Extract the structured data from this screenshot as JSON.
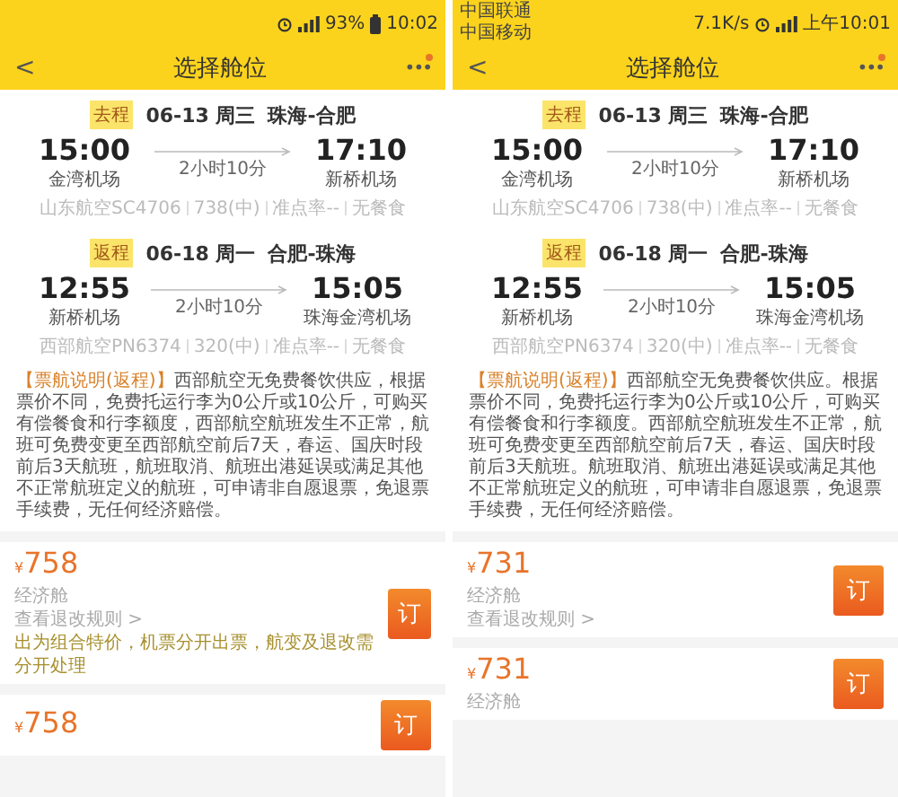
{
  "screens": [
    {
      "status_bar": {
        "battery": "93%",
        "time": "10:02"
      },
      "header": {
        "back": "<",
        "title": "选择舱位",
        "more": "•••",
        "badge": true
      },
      "trips": [
        {
          "tag": "去程",
          "date": "06-13 周三",
          "route": "珠海-合肥",
          "depart_time": "15:00",
          "depart_airport": "金湾机场",
          "duration": "2小时10分",
          "arrive_time": "17:10",
          "arrive_airport": "新桥机场",
          "info": [
            "山东航空SC4706",
            "738(中)",
            "准点率--",
            "无餐食"
          ]
        },
        {
          "tag": "返程",
          "date": "06-18 周一",
          "route": "合肥-珠海",
          "depart_time": "12:55",
          "depart_airport": "新桥机场",
          "duration": "2小时10分",
          "arrive_time": "15:05",
          "arrive_airport": "珠海金湾机场",
          "info": [
            "西部航空PN6374",
            "320(中)",
            "准点率--",
            "无餐食"
          ]
        }
      ],
      "notice": {
        "label": "【票航说明(返程)】",
        "text": "西部航空无免费餐饮供应，根据票价不同，免费托运行李为0公斤或10公斤，可购买有偿餐食和行李额度，西部航空航班发生不正常，航班可免费变更至西部航空前后7天，春运、国庆时段前后3天航班，航班取消、航班出港延误或满足其他不正常航班定义的航班，可申请非自愿退票，免退票手续费，无任何经济赔偿。"
      },
      "fares": [
        {
          "currency": "¥",
          "price": "758",
          "cabin": "经济舱",
          "rules": "查看退改规则 >",
          "note": "出为组合特价，机票分开出票，航变及退改需分开处理",
          "book": "订"
        },
        {
          "currency": "¥",
          "price": "758",
          "book": "订"
        }
      ]
    },
    {
      "status_bar": {
        "carrier": [
          "中国联通",
          "中国移动"
        ],
        "speed": "7.1K/s",
        "time": "上午10:01"
      },
      "header": {
        "back": "<",
        "title": "选择舱位",
        "more": "•••",
        "badge": true
      },
      "trips": [
        {
          "tag": "去程",
          "date": "06-13 周三",
          "route": "珠海-合肥",
          "depart_time": "15:00",
          "depart_airport": "金湾机场",
          "duration": "2小时10分",
          "arrive_time": "17:10",
          "arrive_airport": "新桥机场",
          "info": [
            "山东航空SC4706",
            "738(中)",
            "准点率--",
            "无餐食"
          ]
        },
        {
          "tag": "返程",
          "date": "06-18 周一",
          "route": "合肥-珠海",
          "depart_time": "12:55",
          "depart_airport": "新桥机场",
          "duration": "2小时10分",
          "arrive_time": "15:05",
          "arrive_airport": "珠海金湾机场",
          "info": [
            "西部航空PN6374",
            "320(中)",
            "准点率--",
            "无餐食"
          ]
        }
      ],
      "notice": {
        "label": "【票航说明(返程)】",
        "text": "西部航空无免费餐饮供应。根据票价不同，免费托运行李为0公斤或10公斤，可购买有偿餐食和行李额度。西部航空航班发生不正常，航班可免费变更至西部航空前后7天，春运、国庆时段前后3天航班。航班取消、航班出港延误或满足其他不正常航班定义的航班，可申请非自愿退票，免退票手续费，无任何经济赔偿。"
      },
      "fares": [
        {
          "currency": "¥",
          "price": "731",
          "cabin": "经济舱",
          "rules": "查看退改规则 >",
          "book": "订"
        },
        {
          "currency": "¥",
          "price": "731",
          "cabin": "经济舱",
          "book": "订"
        }
      ]
    }
  ]
}
